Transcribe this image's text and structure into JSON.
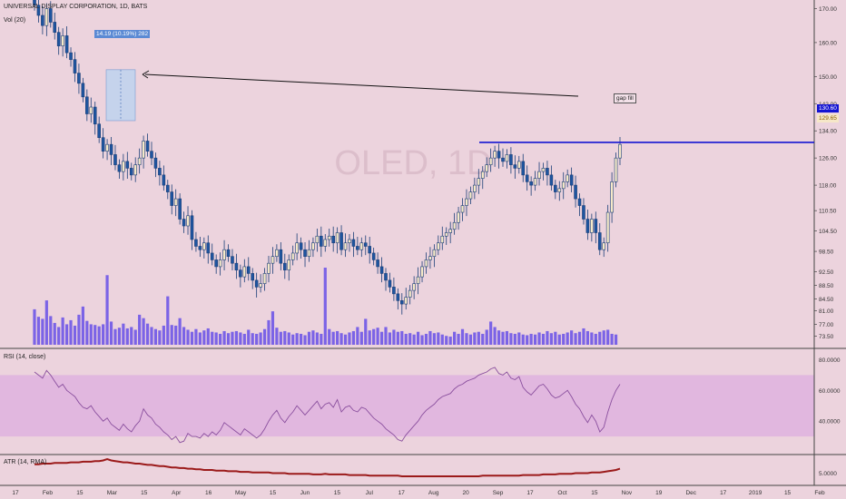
{
  "header": {
    "symbol_line": "UNIVERSAL DISPLAY CORPORATION, 1D, BATS",
    "volume_label": "Vol (20)"
  },
  "watermark": "OLED, 1D",
  "measure_label": "14.19 (10.19%) 282",
  "gap_label": "gap fill",
  "rsi_label": "RSI (14, close)",
  "atr_label": "ATR (14, RMA)",
  "price_badges": {
    "resistance": "130.60",
    "last": "129.65"
  },
  "colors": {
    "background": "#ecd3dd",
    "up": "#1e55a0",
    "down": "#1e55a0",
    "wick": "#1b3f78",
    "volume": "#7b63e6",
    "resistance": "#1414d2",
    "arrow": "#111111",
    "rsi_line": "#8a4f9e",
    "rsi_band": "#e1b7df",
    "atr_line": "#9b1a1a"
  },
  "chart_data": [
    {
      "type": "candlestick",
      "title": "UNIVERSAL DISPLAY CORPORATION, 1D, BATS",
      "ylim": [
        71,
        172
      ],
      "y_ticks": [
        "170.00",
        "160.00",
        "150.00",
        "142.00",
        "134.00",
        "126.00",
        "118.00",
        "110.50",
        "104.50",
        "98.50",
        "92.50",
        "88.50",
        "84.50",
        "81.00",
        "77.00",
        "73.50"
      ],
      "x_ticks": [
        "17",
        "Feb",
        "15",
        "Mar",
        "15",
        "Apr",
        "16",
        "May",
        "15",
        "Jun",
        "15",
        "Jul",
        "17",
        "Aug",
        "20",
        "Sep",
        "17",
        "Oct",
        "15",
        "Nov",
        "19",
        "Dec",
        "17",
        "2019",
        "15",
        "Feb"
      ],
      "closes": [
        171,
        168,
        165,
        170,
        166,
        163,
        159,
        162,
        157,
        155,
        151,
        148,
        144,
        139,
        141,
        136,
        132,
        128,
        130,
        127,
        124,
        122,
        125,
        123,
        121,
        124,
        126,
        131,
        128,
        126,
        123,
        121,
        118,
        116,
        112,
        114,
        108,
        106,
        109,
        102,
        100,
        99,
        101,
        98,
        96,
        94,
        96,
        99,
        97,
        95,
        93,
        91,
        94,
        92,
        90,
        88,
        89,
        92,
        95,
        97,
        99,
        95,
        93,
        96,
        98,
        101,
        99,
        97,
        99,
        101,
        103,
        100,
        102,
        103,
        101,
        104,
        99,
        101,
        102,
        100,
        99,
        101,
        100,
        98,
        96,
        94,
        92,
        90,
        88,
        86,
        84,
        83,
        85,
        87,
        89,
        91,
        94,
        96,
        97,
        99,
        101,
        103,
        104,
        105,
        107,
        110,
        112,
        114,
        116,
        118,
        120,
        122,
        124,
        126,
        128,
        126,
        125,
        127,
        124,
        123,
        125,
        121,
        119,
        118,
        120,
        122,
        123,
        121,
        118,
        116,
        117,
        119,
        121,
        118,
        114,
        112,
        108,
        104,
        108,
        104,
        99,
        101,
        110,
        119,
        126,
        130
      ],
      "volume": [
        5.2,
        4.1,
        3.8,
        6.5,
        4.2,
        3.2,
        2.6,
        4.0,
        3.0,
        3.6,
        2.8,
        4.4,
        5.6,
        3.5,
        3.0,
        2.9,
        2.7,
        3.0,
        10.2,
        3.4,
        2.3,
        2.5,
        3.1,
        2.4,
        2.6,
        2.2,
        4.4,
        3.9,
        3.1,
        2.6,
        2.3,
        2.1,
        2.8,
        7.1,
        2.9,
        2.8,
        3.9,
        2.6,
        2.2,
        1.9,
        2.3,
        1.8,
        2.1,
        2.4,
        1.9,
        1.8,
        1.6,
        2.0,
        1.7,
        1.9,
        2.0,
        1.8,
        1.6,
        2.2,
        1.7,
        1.6,
        1.8,
        2.3,
        3.6,
        4.9,
        2.5,
        1.9,
        2.0,
        1.8,
        1.5,
        1.7,
        1.6,
        1.4,
        1.9,
        2.1,
        1.8,
        1.6,
        11.3,
        2.3,
        1.9,
        2.0,
        1.7,
        1.5,
        1.8,
        2.0,
        2.6,
        1.9,
        3.8,
        2.1,
        2.3,
        2.5,
        1.9,
        2.6,
        1.8,
        2.2,
        1.9,
        2.0,
        1.6,
        1.7,
        1.5,
        1.9,
        1.4,
        1.6,
        2.0,
        1.7,
        1.8,
        1.5,
        1.3,
        1.2,
        1.9,
        1.6,
        2.3,
        1.7,
        1.5,
        1.8,
        1.9,
        1.6,
        2.2,
        3.4,
        2.6,
        2.1,
        1.9,
        2.0,
        1.7,
        1.6,
        1.8,
        1.5,
        1.4,
        1.6,
        1.5,
        1.8,
        1.6,
        2.0,
        1.7,
        1.9,
        1.5,
        1.6,
        1.8,
        2.1,
        1.7,
        1.9,
        2.4,
        2.0,
        1.8,
        1.6,
        1.9,
        2.1,
        2.2,
        1.6,
        1.5
      ]
    },
    {
      "type": "line",
      "title": "RSI (14, close)",
      "ylim": [
        20,
        85
      ],
      "band": [
        30,
        70
      ],
      "y_ticks": [
        "80.0000",
        "60.0000",
        "40.0000"
      ],
      "values": [
        72,
        70,
        68,
        73,
        70,
        66,
        62,
        64,
        60,
        58,
        56,
        52,
        49,
        48,
        50,
        46,
        43,
        40,
        42,
        38,
        36,
        34,
        38,
        35,
        33,
        37,
        40,
        48,
        44,
        42,
        38,
        36,
        33,
        31,
        28,
        30,
        26,
        27,
        32,
        30,
        30,
        29,
        32,
        30,
        33,
        31,
        34,
        39,
        37,
        35,
        33,
        31,
        35,
        33,
        31,
        29,
        31,
        35,
        40,
        44,
        47,
        42,
        39,
        43,
        46,
        50,
        47,
        44,
        47,
        50,
        53,
        48,
        51,
        52,
        49,
        54,
        46,
        49,
        50,
        47,
        46,
        49,
        48,
        45,
        42,
        40,
        38,
        35,
        33,
        31,
        28,
        27,
        31,
        34,
        37,
        40,
        44,
        47,
        49,
        51,
        54,
        56,
        57,
        58,
        61,
        63,
        64,
        66,
        67,
        68,
        70,
        71,
        72,
        74,
        75,
        71,
        70,
        72,
        68,
        67,
        69,
        62,
        59,
        57,
        60,
        63,
        64,
        61,
        57,
        55,
        56,
        58,
        60,
        56,
        51,
        48,
        43,
        39,
        44,
        40,
        33,
        36,
        46,
        54,
        60,
        64
      ]
    },
    {
      "type": "line",
      "title": "ATR (14, RMA)",
      "ylim": [
        3.5,
        7.5
      ],
      "y_ticks": [
        "5.0000"
      ],
      "values": [
        6.4,
        6.4,
        6.5,
        6.5,
        6.5,
        6.6,
        6.6,
        6.6,
        6.6,
        6.7,
        6.7,
        6.7,
        6.8,
        6.8,
        6.8,
        6.9,
        6.9,
        7.0,
        7.2,
        7.0,
        6.9,
        6.8,
        6.7,
        6.7,
        6.6,
        6.5,
        6.5,
        6.4,
        6.3,
        6.3,
        6.2,
        6.1,
        6.1,
        6.0,
        5.9,
        5.9,
        5.8,
        5.8,
        5.7,
        5.7,
        5.6,
        5.6,
        5.5,
        5.5,
        5.5,
        5.4,
        5.4,
        5.4,
        5.3,
        5.3,
        5.3,
        5.2,
        5.2,
        5.2,
        5.1,
        5.1,
        5.1,
        5.1,
        5.1,
        5.0,
        5.0,
        5.0,
        5.0,
        4.9,
        4.9,
        4.9,
        4.9,
        4.9,
        4.9,
        4.8,
        4.8,
        4.8,
        4.9,
        4.8,
        4.8,
        4.8,
        4.8,
        4.8,
        4.7,
        4.7,
        4.7,
        4.7,
        4.7,
        4.6,
        4.6,
        4.6,
        4.6,
        4.6,
        4.6,
        4.6,
        4.6,
        4.5,
        4.5,
        4.5,
        4.5,
        4.5,
        4.5,
        4.5,
        4.5,
        4.5,
        4.5,
        4.5,
        4.5,
        4.5,
        4.5,
        4.5,
        4.5,
        4.5,
        4.5,
        4.5,
        4.5,
        4.6,
        4.6,
        4.6,
        4.6,
        4.6,
        4.6,
        4.6,
        4.6,
        4.6,
        4.6,
        4.7,
        4.7,
        4.7,
        4.7,
        4.7,
        4.8,
        4.8,
        4.8,
        4.8,
        4.9,
        4.9,
        4.9,
        4.9,
        5.0,
        5.0,
        5.0,
        5.0,
        5.1,
        5.1,
        5.1,
        5.2,
        5.3,
        5.4,
        5.5,
        5.7
      ]
    }
  ]
}
